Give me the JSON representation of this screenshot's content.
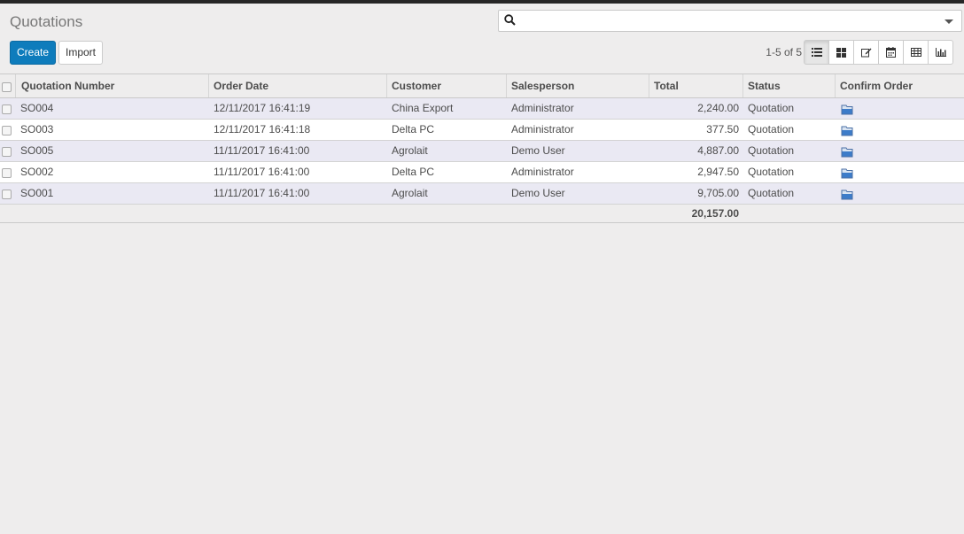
{
  "page": {
    "title": "Quotations"
  },
  "search": {
    "placeholder": "",
    "value": ""
  },
  "toolbar": {
    "create_label": "Create",
    "import_label": "Import"
  },
  "pager": {
    "text": "1-5 of 5"
  },
  "views": [
    "list",
    "kanban",
    "form",
    "calendar",
    "pivot",
    "graph"
  ],
  "table": {
    "headers": [
      "Quotation Number",
      "Order Date",
      "Customer",
      "Salesperson",
      "Total",
      "Status",
      "Confirm Order"
    ],
    "rows": [
      {
        "number": "SO004",
        "date": "12/11/2017 16:41:19",
        "customer": "China Export",
        "salesperson": "Administrator",
        "total": "2,240.00",
        "status": "Quotation"
      },
      {
        "number": "SO003",
        "date": "12/11/2017 16:41:18",
        "customer": "Delta PC",
        "salesperson": "Administrator",
        "total": "377.50",
        "status": "Quotation"
      },
      {
        "number": "SO005",
        "date": "11/11/2017 16:41:00",
        "customer": "Agrolait",
        "salesperson": "Demo User",
        "total": "4,887.00",
        "status": "Quotation"
      },
      {
        "number": "SO002",
        "date": "11/11/2017 16:41:00",
        "customer": "Delta PC",
        "salesperson": "Administrator",
        "total": "2,947.50",
        "status": "Quotation"
      },
      {
        "number": "SO001",
        "date": "11/11/2017 16:41:00",
        "customer": "Agrolait",
        "salesperson": "Demo User",
        "total": "9,705.00",
        "status": "Quotation"
      }
    ],
    "footer_total": "20,157.00"
  },
  "colors": {
    "primary": "#0e7cbc",
    "row_alt": "#eae9f3",
    "background": "#eeeded"
  }
}
